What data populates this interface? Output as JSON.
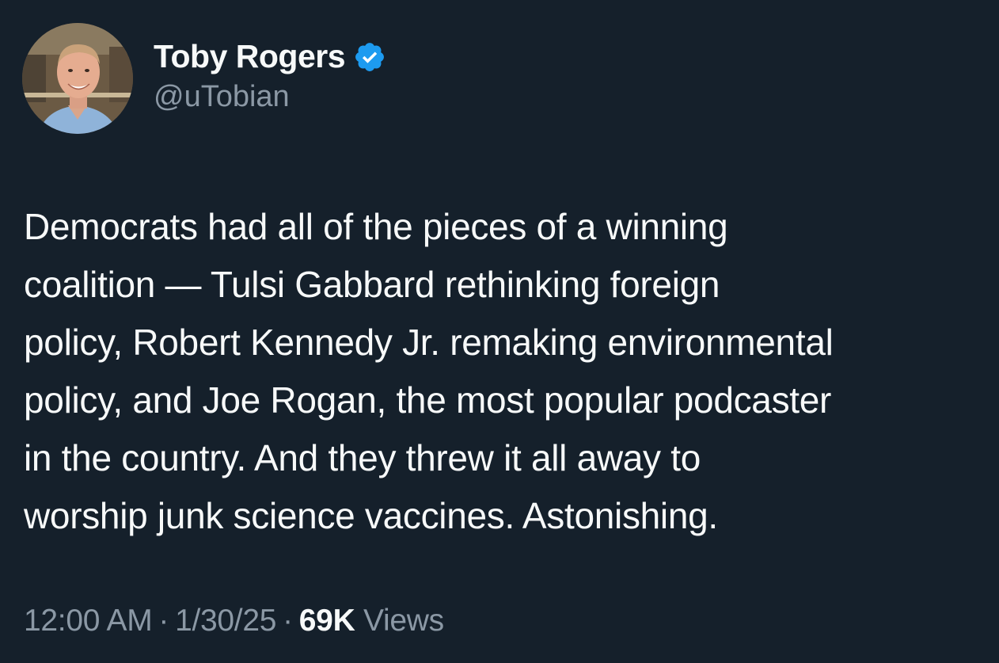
{
  "author": {
    "display_name": "Toby Rogers",
    "handle": "@uTobian",
    "verified": true,
    "verified_color": "#1d9bf0"
  },
  "tweet": {
    "lines": [
      "Democrats had all of the pieces of a winning",
      "coalition — Tulsi Gabbard rethinking foreign",
      "policy, Robert Kennedy Jr. remaking environmental",
      "policy, and Joe Rogan, the most popular podcaster",
      "in the country. And they threw it all away to",
      "worship junk science vaccines. Astonishing."
    ]
  },
  "meta": {
    "time": "12:00 AM",
    "separator": "·",
    "date": "1/30/25",
    "views_count": "69K",
    "views_label": "Views"
  },
  "theme": {
    "background": "#15202b",
    "text": "#f7f9f9",
    "secondary": "#8b98a5"
  }
}
